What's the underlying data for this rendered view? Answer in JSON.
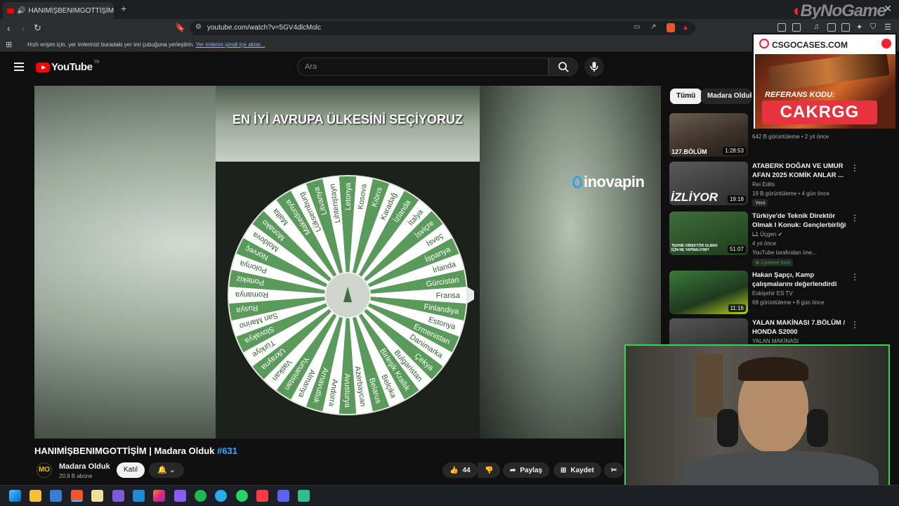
{
  "browser": {
    "tab_title": "HANIMİŞBENIMGOTTİŞİM | M",
    "url": "youtube.com/watch?v=5GV4dlcMolc",
    "bookmarks_prompt": "Hızlı erişim için, yer imlerinizi buradaki yer imi çubuğuna yerleştirin.",
    "bookmarks_link": "Yer imlerini şimdi içe aktar..."
  },
  "overlay_brand": "ByNoGame",
  "youtube": {
    "logo": "YouTube",
    "country_code": "TR",
    "search_placeholder": "Ara"
  },
  "video": {
    "overlay_title": "EN İYİ AVRUPA ÜLKESİNİ SEÇİYORUZ",
    "watermark": "inovapin",
    "wheel_labels": [
      "Fransa",
      "Finlandiya",
      "Estonya",
      "Ermenistan",
      "Danimarka",
      "Çekya",
      "Bulgaristan",
      "Birleşik Krallık",
      "Belçika",
      "Belarus",
      "Azerbaycan",
      "Avusturya",
      "Andorra",
      "Arnavutluk",
      "Almanya",
      "Yunanistan",
      "Vatikan",
      "Ukrayna",
      "Türkiye",
      "Slovakya",
      "San Marino",
      "Rusya",
      "Romanya",
      "Portekiz",
      "Polonya",
      "Norveç",
      "Moldova",
      "Monako",
      "Malta",
      "Makedonya",
      "Lüksemburg",
      "Litvanya",
      "Lihtenştayn",
      "Letonya",
      "Kosova",
      "Kıbrıs",
      "Karadağ",
      "İzlanda",
      "İtalya",
      "İsviçre",
      "İsveç",
      "İspanya",
      "İrlanda",
      "Gürcistan"
    ],
    "title_main": "HANIMİŞBENIMGOTTİŞİM | Madara Olduk ",
    "title_tag": "#631",
    "channel_name": "Madara Olduk",
    "channel_initials": "MO",
    "subscribers": "20,9 B abone",
    "join_label": "Katıl",
    "like_count": "44",
    "share_label": "Paylaş",
    "save_label": "Kaydet"
  },
  "sidebar": {
    "chips": [
      "Tümü",
      "Madara Olduk"
    ],
    "recommendations": [
      {
        "title": "",
        "thumb_text": "127.BÖLÜM",
        "duration": "1:28:53",
        "meta": "642 B görüntüleme • 2 yıl önce",
        "thumb_color": "#4a4238"
      },
      {
        "title": "ATABERK DOĞAN VE UMUR AFAN 2025 KOMİK ANLAR ...",
        "thumb_text": "İZLİYOR",
        "duration": "19:18",
        "channel": "Rei Edits",
        "meta": "19 B görüntüleme • 4 gün önce",
        "badge": "Yeni",
        "thumb_color": "#3a3a3a"
      },
      {
        "title": "Türkiye'de Teknik Direktör Olmak I Konuk: Gençlerbirliği ...",
        "thumb_text": "TEKNİK DİREKTÖR OLMAK İÇİN NE YAPMALIYIM?",
        "duration": "51:07",
        "channel": "L1 Üçgen",
        "meta": "4 yıl önce",
        "meta2": "YouTube tarafından öne...",
        "badge": "Üyelere özel",
        "thumb_color": "#2d5a2a"
      },
      {
        "title": "Hakan Şapçı, Kamp çalışmalarını değerlendirdi",
        "thumb_text": "",
        "duration": "11:16",
        "channel": "Eskişehir ES TV",
        "meta": "69 görüntüleme • 8 gün önce",
        "thumb_color": "#2a4a2a"
      },
      {
        "title": "YALAN MAKİNASI 7.BÖLÜM / HONDA S2000",
        "thumb_text": "",
        "duration": "",
        "channel": "YALAN MAKİNASI",
        "meta": "",
        "thumb_color": "#444"
      }
    ]
  },
  "ad": {
    "brand": "CSGOCASES.COM",
    "code_label": "REFERANS KODU:",
    "code": "CAKRGG"
  },
  "colors": {
    "accent_link": "#3ea6ff",
    "wheel_green": "#5a9a5a",
    "wheel_white": "#ffffff",
    "cam_border": "#39d353"
  }
}
